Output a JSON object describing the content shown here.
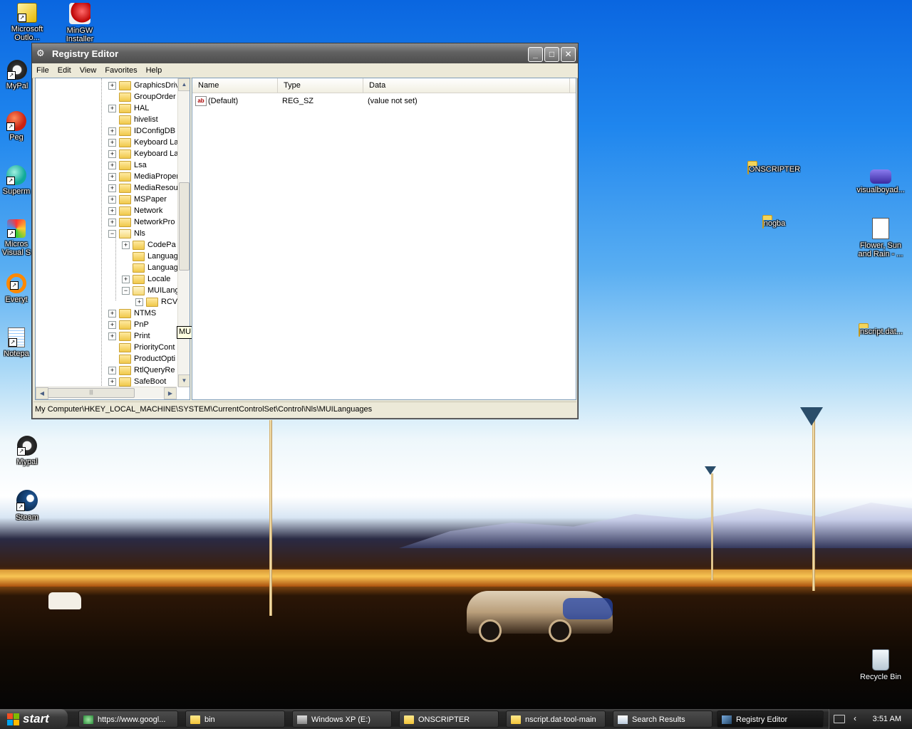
{
  "desktop": {
    "icons_left": [
      {
        "label": "Microsoft Outlook",
        "display": "Microsoft Outlo..."
      },
      {
        "label": "MinGW Installer",
        "display": "MinGW Installer"
      },
      {
        "label": "MyPal",
        "display": "MyPal"
      },
      {
        "label": "Peg",
        "display": "Peg"
      },
      {
        "label": "Superm",
        "display": "Superm"
      },
      {
        "label": "Micros Visual S",
        "display": "Micros Visual S"
      },
      {
        "label": "Everyt",
        "display": "Everyt"
      },
      {
        "label": "Notepa",
        "display": "Notepa"
      },
      {
        "label": "Mypal",
        "display": "Mypal"
      },
      {
        "label": "Steam",
        "display": "Steam"
      }
    ],
    "icons_right": [
      {
        "label": "ONSCRIPTER"
      },
      {
        "label": "visualboyad..."
      },
      {
        "label": "nogba"
      },
      {
        "label": "Flower, Sun and Rain - ..."
      },
      {
        "label": "nscript.dat..."
      },
      {
        "label": "Recycle Bin"
      }
    ]
  },
  "window": {
    "title": "Registry Editor",
    "buttons": {
      "minimize": "_",
      "maximize": "□",
      "close": "✕"
    },
    "menu": [
      "File",
      "Edit",
      "View",
      "Favorites",
      "Help"
    ],
    "tree": [
      {
        "label": "GraphicsDriv",
        "expander": "+"
      },
      {
        "label": "GroupOrder",
        "expander": ""
      },
      {
        "label": "HAL",
        "expander": "+"
      },
      {
        "label": "hivelist",
        "expander": ""
      },
      {
        "label": "IDConfigDB",
        "expander": "+"
      },
      {
        "label": "Keyboard La",
        "expander": "+"
      },
      {
        "label": "Keyboard La",
        "expander": "+"
      },
      {
        "label": "Lsa",
        "expander": "+"
      },
      {
        "label": "MediaProper",
        "expander": "+"
      },
      {
        "label": "MediaResou",
        "expander": "+"
      },
      {
        "label": "MSPaper",
        "expander": "+"
      },
      {
        "label": "Network",
        "expander": "+"
      },
      {
        "label": "NetworkPro",
        "expander": "+"
      },
      {
        "label": "Nls",
        "expander": "−"
      },
      {
        "label": "CodePa",
        "expander": "+"
      },
      {
        "label": "Languag",
        "expander": ""
      },
      {
        "label": "Languag",
        "expander": ""
      },
      {
        "label": "Locale",
        "expander": "+"
      },
      {
        "label": "MUILanguages",
        "expander": "−"
      },
      {
        "label": "RCV",
        "expander": "+"
      },
      {
        "label": "NTMS",
        "expander": "+"
      },
      {
        "label": "PnP",
        "expander": "+"
      },
      {
        "label": "Print",
        "expander": "+"
      },
      {
        "label": "PriorityCont",
        "expander": ""
      },
      {
        "label": "ProductOpti",
        "expander": ""
      },
      {
        "label": "RtlQueryRe",
        "expander": "+"
      },
      {
        "label": "SafeBoot",
        "expander": "+"
      }
    ],
    "tooltip": "MUILanguages",
    "list": {
      "columns": [
        "Name",
        "Type",
        "Data"
      ],
      "rows": [
        {
          "name": "(Default)",
          "type": "REG_SZ",
          "data": "(value not set)"
        }
      ]
    },
    "status": "My Computer\\HKEY_LOCAL_MACHINE\\SYSTEM\\CurrentControlSet\\Control\\Nls\\MUILanguages"
  },
  "taskbar": {
    "start_label": "start",
    "items": [
      {
        "label": "https://www.googl...",
        "icon": "browser-icon"
      },
      {
        "label": "bin",
        "icon": "folder-icon"
      },
      {
        "label": "Windows XP (E:)",
        "icon": "drive-icon"
      },
      {
        "label": "ONSCRIPTER",
        "icon": "folder-icon"
      },
      {
        "label": "nscript.dat-tool-main",
        "icon": "folder-icon"
      },
      {
        "label": "Search Results",
        "icon": "search-results-icon"
      },
      {
        "label": "Registry Editor",
        "icon": "registry-icon",
        "active": true
      }
    ],
    "clock": "3:51 AM"
  }
}
